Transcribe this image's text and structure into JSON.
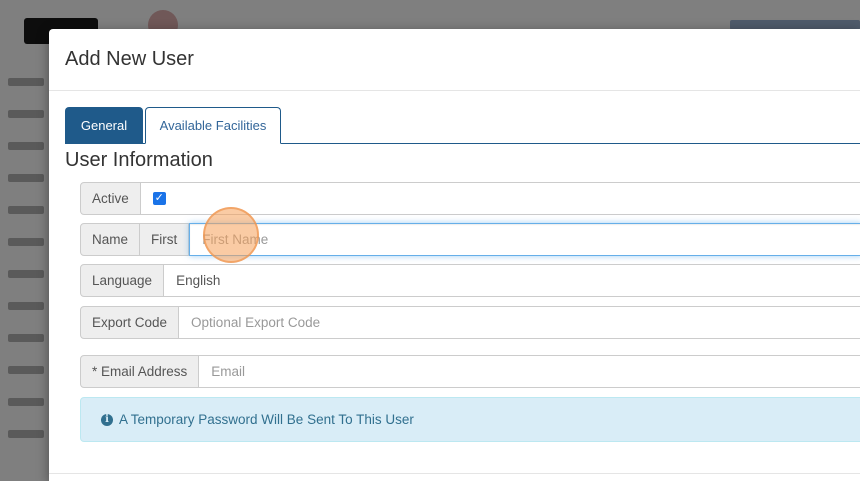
{
  "modal": {
    "title": "Add New User"
  },
  "tabs": [
    {
      "label": "General",
      "active": true
    },
    {
      "label": "Available Facilities",
      "active": false
    }
  ],
  "section": {
    "title": "User Information"
  },
  "form": {
    "active": {
      "label": "Active",
      "checked": true
    },
    "name": {
      "label": "Name",
      "sub_label": "First",
      "placeholder": "First Name"
    },
    "language": {
      "label": "Language",
      "value": "English"
    },
    "export_code": {
      "label": "Export Code",
      "placeholder": "Optional Export Code"
    },
    "email": {
      "label": "* Email Address",
      "placeholder": "Email"
    }
  },
  "info": {
    "icon": "info-icon",
    "message": "A Temporary Password Will Be Sent To This User"
  },
  "colors": {
    "primary": "#1f5a8a",
    "info_bg": "#d9edf7",
    "info_text": "#31708f",
    "checkbox": "#1a73e8"
  }
}
